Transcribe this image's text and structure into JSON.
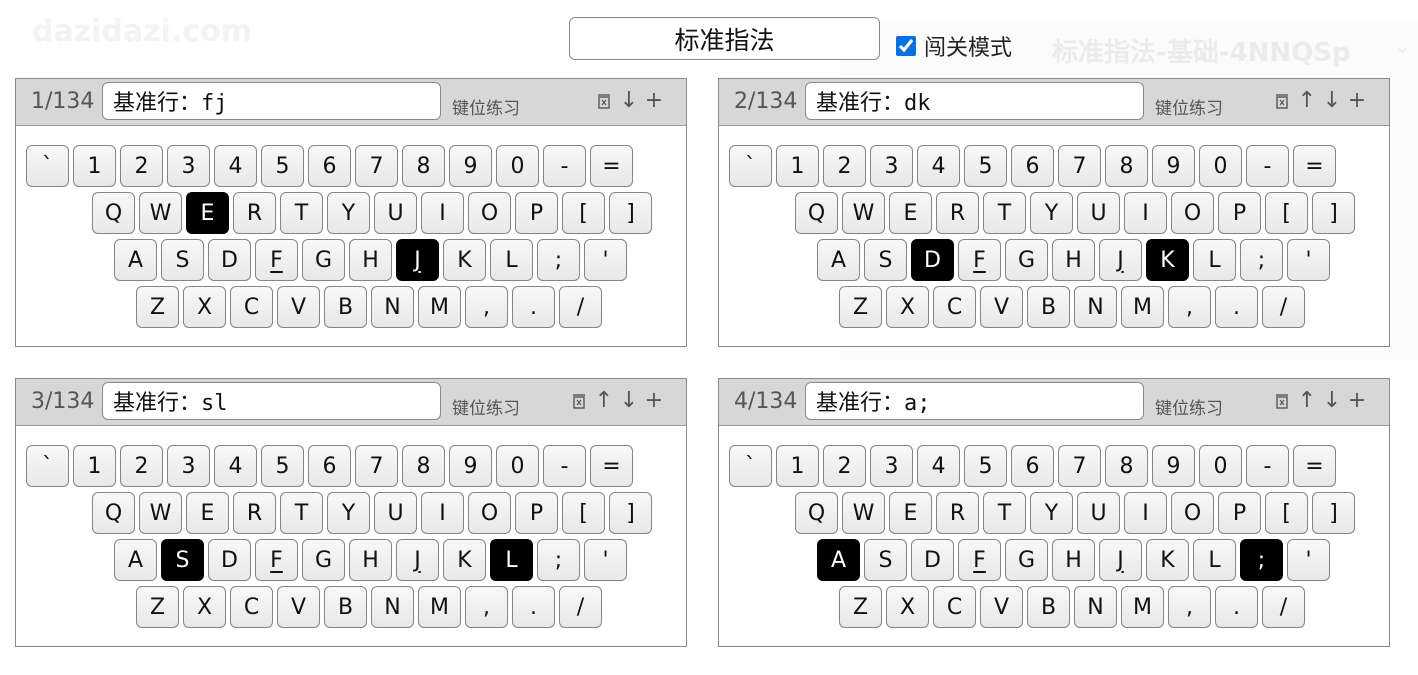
{
  "watermark": {
    "site": "dazidazi.com",
    "title": "标准指法-基础-4NNQSp"
  },
  "header": {
    "title_value": "标准指法",
    "challenge_checked": true,
    "challenge_label": "闯关模式"
  },
  "accent_color": "#0b6fe0",
  "keyboard_rows": [
    [
      "`",
      "1",
      "2",
      "3",
      "4",
      "5",
      "6",
      "7",
      "8",
      "9",
      "0",
      "-",
      "="
    ],
    [
      "Q",
      "W",
      "E",
      "R",
      "T",
      "Y",
      "U",
      "I",
      "O",
      "P",
      "[",
      "]"
    ],
    [
      "A",
      "S",
      "D",
      "F",
      "G",
      "H",
      "J",
      "K",
      "L",
      ";",
      "'"
    ],
    [
      "Z",
      "X",
      "C",
      "V",
      "B",
      "N",
      "M",
      ",",
      ".",
      "/"
    ]
  ],
  "bump_keys": [
    "F",
    "J"
  ],
  "panels": [
    {
      "counter": "1/134",
      "lesson": "基准行：fj",
      "mode": "键位练习",
      "actions": [
        "delete",
        "down",
        "add"
      ],
      "highlight": [
        "E",
        "J"
      ]
    },
    {
      "counter": "2/134",
      "lesson": "基准行：dk",
      "mode": "键位练习",
      "actions": [
        "delete",
        "up",
        "down",
        "add"
      ],
      "highlight": [
        "D",
        "K"
      ]
    },
    {
      "counter": "3/134",
      "lesson": "基准行：sl",
      "mode": "键位练习",
      "actions": [
        "delete",
        "up",
        "down",
        "add"
      ],
      "highlight": [
        "S",
        "L"
      ]
    },
    {
      "counter": "4/134",
      "lesson": "基准行：a;",
      "mode": "键位练习",
      "actions": [
        "delete",
        "up",
        "down",
        "add"
      ],
      "highlight": [
        "A",
        ";"
      ]
    }
  ]
}
